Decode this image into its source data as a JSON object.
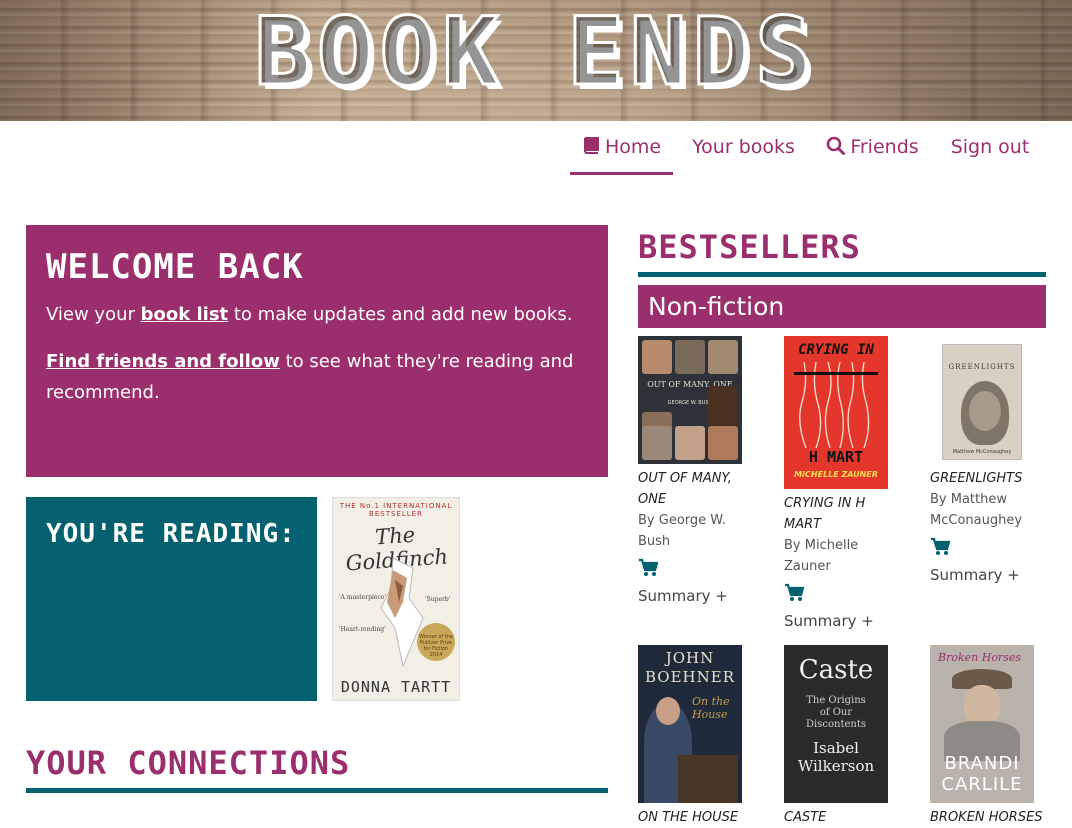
{
  "brand": {
    "logo_text": "BOOK ENDS"
  },
  "nav": {
    "home": "Home",
    "your_books": "Your books",
    "friends": "Friends",
    "sign_out": "Sign out"
  },
  "welcome": {
    "title": "WELCOME BACK",
    "line1_pre": "View your ",
    "line1_link": "book list",
    "line1_post": " to make updates and add new books.",
    "line2_link": "Find friends and follow",
    "line2_post": " to see what they're reading and recommend."
  },
  "reading": {
    "title": "YOU'RE READING:",
    "cover": {
      "banner": "THE No.1 INTERNATIONAL BESTSELLER",
      "title": "The Goldfinch",
      "author": "DONNA TARTT",
      "quote1": "'A masterpiece'",
      "quote2": "'Superb'",
      "quote3": "'Heart-rending'",
      "seal": "Winner of the Pulitzer Prize for Fiction 2014"
    }
  },
  "connections": {
    "title": "YOUR CONNECTIONS"
  },
  "bestsellers": {
    "title": "BESTSELLERS",
    "category": "Non-fiction",
    "books": [
      {
        "title": "OUT OF MANY, ONE",
        "author": "By George W. Bush",
        "summary": "Summary +",
        "cover_text": "OUT OF MANY, ONE",
        "cover_sub": "GEORGE W. BUSH",
        "colors": {
          "bg": "#2d3138",
          "accent": "#7a5b47"
        }
      },
      {
        "title": "CRYING IN H MART",
        "author": "By Michelle Zauner",
        "summary": "Summary +",
        "cover_text": "CRYING IN H MART",
        "cover_sub": "MICHELLE ZAUNER",
        "colors": {
          "bg": "#e4362b",
          "accent": "#f4e04d"
        }
      },
      {
        "title": "GREENLIGHTS",
        "author": "By Matthew McConaughey",
        "summary": "Summary +",
        "cover_text": "GREENLIGHTS",
        "cover_sub": "Matthew McConaughey",
        "colors": {
          "bg": "#d8d0c2",
          "accent": "#3b3b3b"
        }
      },
      {
        "title": "ON THE HOUSE",
        "author": "",
        "summary": "",
        "cover_text": "JOHN BOEHNER",
        "cover_sub": "On the House",
        "colors": {
          "bg": "#1e2a3a",
          "accent": "#c49a4b"
        }
      },
      {
        "title": "CASTE",
        "author": "",
        "summary": "",
        "cover_text": "Caste",
        "cover_sub": "Isabel Wilkerson",
        "colors": {
          "bg": "#2a2a2a",
          "accent": "#e8e8e8"
        }
      },
      {
        "title": "BROKEN HORSES",
        "author": "",
        "summary": "",
        "cover_text": "BRANDI CARLILE",
        "cover_sub": "Broken Horses",
        "colors": {
          "bg": "#b9b3ac",
          "accent": "#ffffff"
        }
      }
    ]
  },
  "colors": {
    "primary": "#9b2f6e",
    "secondary": "#03606f"
  }
}
